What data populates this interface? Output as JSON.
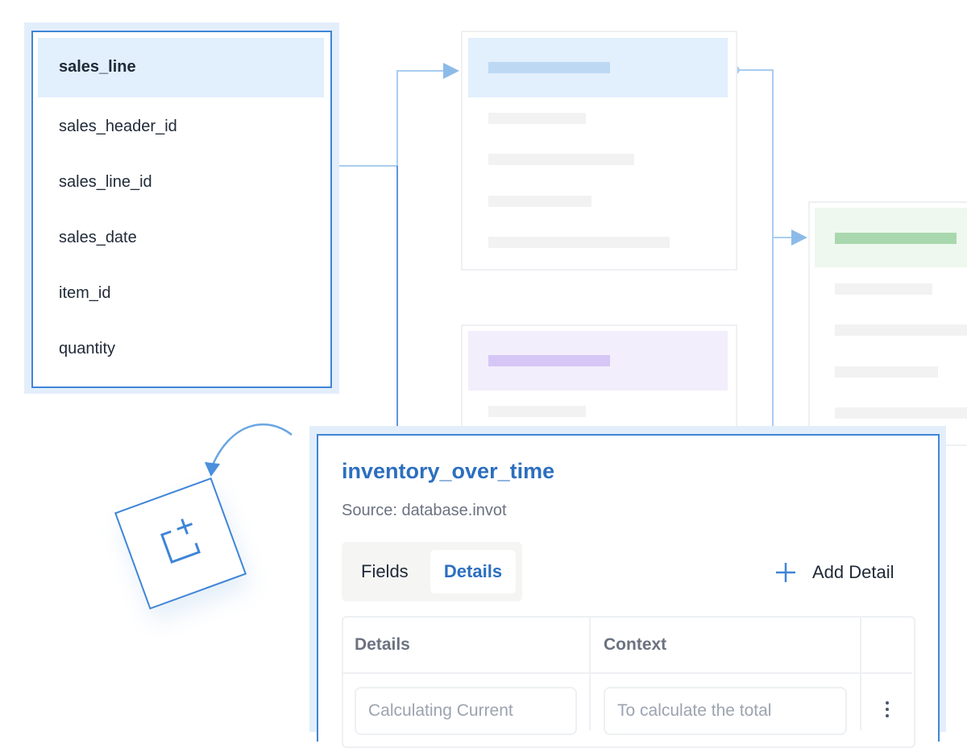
{
  "source_table": {
    "name": "sales_line",
    "fields": [
      "sales_header_id",
      "sales_line_id",
      "sales_date",
      "item_id",
      "quantity"
    ]
  },
  "detail_panel": {
    "title": "inventory_over_time",
    "source": "Source: database.invot",
    "tabs": {
      "fields": "Fields",
      "details": "Details",
      "active": "Details"
    },
    "add_detail_label": "Add Detail",
    "columns": {
      "details": "Details",
      "context": "Context"
    },
    "rows": [
      {
        "details": "Calculating Current",
        "context": "To calculate the total"
      }
    ]
  },
  "icons": {
    "add_widget": "add-square-icon",
    "add_detail": "plus-icon",
    "row_menu": "kebab-menu-icon",
    "curved_arrow": "curved-arrow-icon"
  },
  "colors": {
    "accent": "#3f85d6",
    "title_blue": "#2c6fbf",
    "header_blue": "#e2effc",
    "purple": "#d6c6f6",
    "green": "#a9d8ae"
  }
}
